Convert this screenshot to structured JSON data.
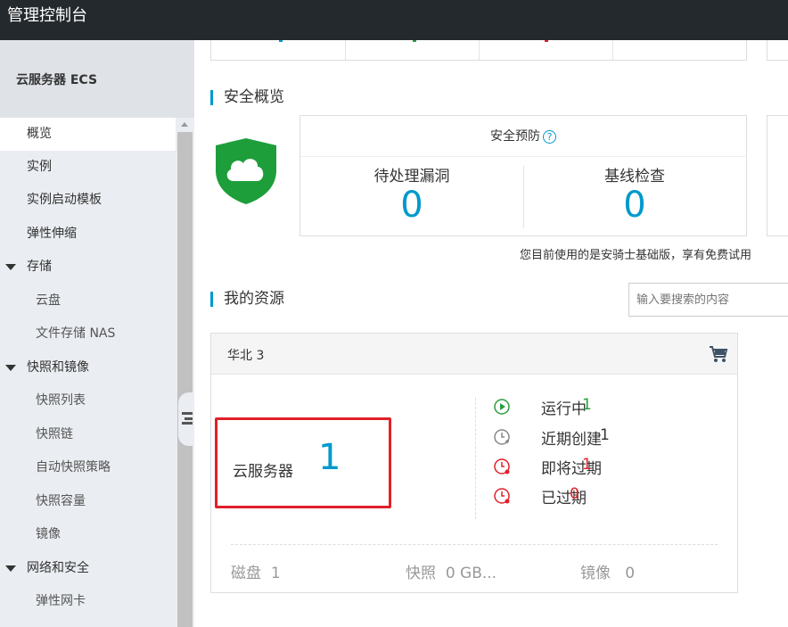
{
  "app": {
    "title": "管理控制台"
  },
  "sidebar": {
    "product": "云服务器 ECS",
    "items": [
      {
        "label": "概览"
      },
      {
        "label": "实例"
      },
      {
        "label": "实例启动模板"
      },
      {
        "label": "弹性伸缩"
      },
      {
        "label": "存储"
      },
      {
        "label": "云盘"
      },
      {
        "label": "文件存储 NAS"
      },
      {
        "label": "快照和镜像"
      },
      {
        "label": "快照列表"
      },
      {
        "label": "快照链"
      },
      {
        "label": "自动快照策略"
      },
      {
        "label": "快照容量"
      },
      {
        "label": "镜像"
      },
      {
        "label": "网络和安全"
      },
      {
        "label": "弹性网卡"
      }
    ]
  },
  "security": {
    "title": "安全概览",
    "card_title": "安全预防",
    "help": "?",
    "metrics": [
      {
        "label": "待处理漏洞",
        "value": "0"
      },
      {
        "label": "基线检查",
        "value": "0"
      }
    ],
    "notice": "您目前使用的是安骑士基础版，享有免费试用"
  },
  "resources": {
    "title": "我的资源",
    "search_placeholder": "输入要搜索的内容",
    "region": "华北 3",
    "server_label": "云服务器",
    "server_count": "1",
    "statuses": [
      {
        "label": "运行中",
        "value": "1"
      },
      {
        "label": "近期创建",
        "value": "1"
      },
      {
        "label": "即将过期",
        "value": "1"
      },
      {
        "label": "已过期",
        "value": "0"
      }
    ],
    "footer": [
      {
        "label": "磁盘",
        "value": "1"
      },
      {
        "label": "快照",
        "value": "0 GB..."
      },
      {
        "label": "镜像",
        "value": "0"
      }
    ]
  },
  "colors": {
    "accent": "#0099cc",
    "topbar": "#24292d",
    "green": "#2a9d3f",
    "red": "#e0202a",
    "highlight": "#e0202a"
  }
}
